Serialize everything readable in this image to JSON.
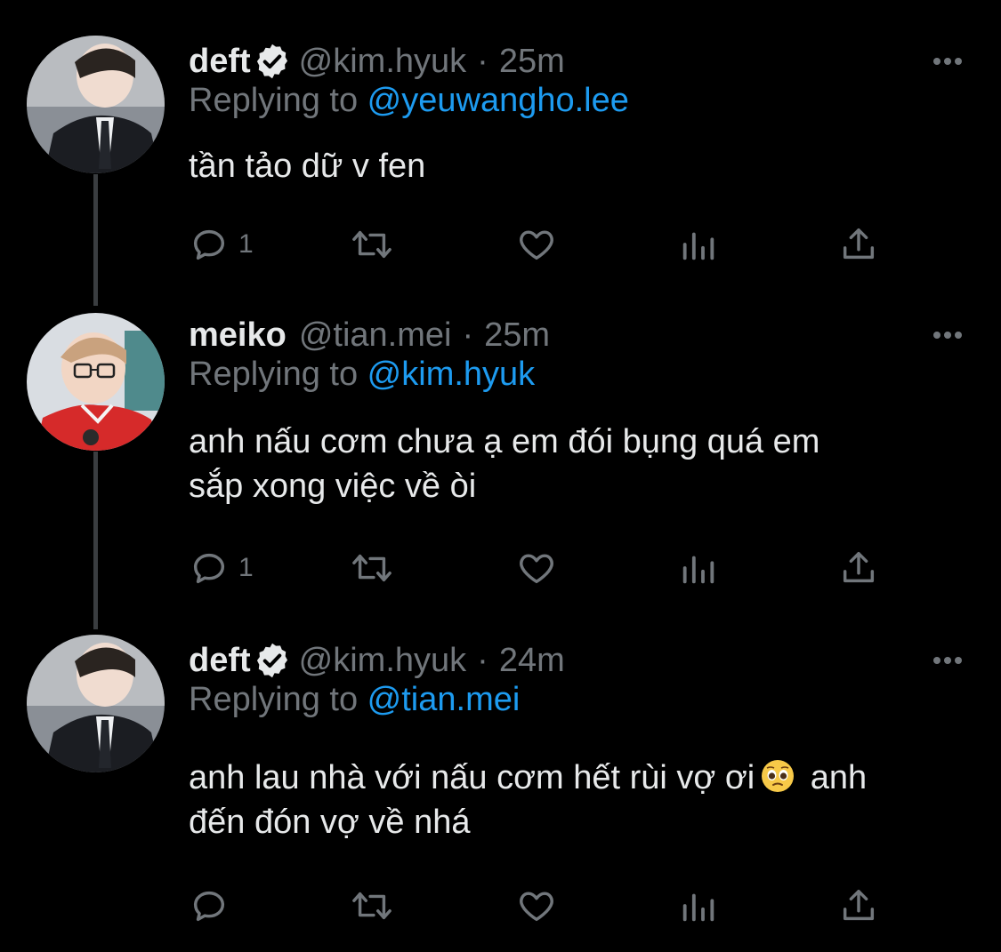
{
  "tweets": [
    {
      "display_name": "deft",
      "verified": true,
      "handle": "@kim.hyuk",
      "separator": "·",
      "time": "25m",
      "reply_prefix": "Replying to ",
      "reply_target": "@yeuwangho.lee",
      "text_lines": [
        "tần tảo dữ v fen"
      ],
      "reply_count": "1"
    },
    {
      "display_name": "meiko",
      "verified": false,
      "handle": "@tian.mei",
      "separator": "·",
      "time": "25m",
      "reply_prefix": "Replying to ",
      "reply_target": "@kim.hyuk",
      "text_lines": [
        "anh nấu cơm chưa ạ em đói bụng quá em",
        "sắp xong việc về òi"
      ],
      "reply_count": "1"
    },
    {
      "display_name": "deft",
      "verified": true,
      "handle": "@kim.hyuk",
      "separator": "·",
      "time": "24m",
      "reply_prefix": "Replying to ",
      "reply_target": "@tian.mei",
      "text_line1_before_emoji": "anh lau nhà với nấu cơm hết rùi vợ ơi",
      "text_line1_after_emoji": " anh",
      "text_line2": "đến đón vợ về nhá",
      "reply_count": ""
    }
  ],
  "icons": {
    "verified": "verified-badge-icon",
    "more": "more-options-icon",
    "reply": "reply-icon",
    "retweet": "retweet-icon",
    "like": "like-icon",
    "views": "views-icon",
    "share": "share-icon",
    "emoji": "pleading-face-emoji"
  },
  "colors": {
    "background": "#000000",
    "text": "#e7e9ea",
    "secondary": "#71767b",
    "link": "#1d9bf0",
    "thread_line": "#3a3d40"
  }
}
